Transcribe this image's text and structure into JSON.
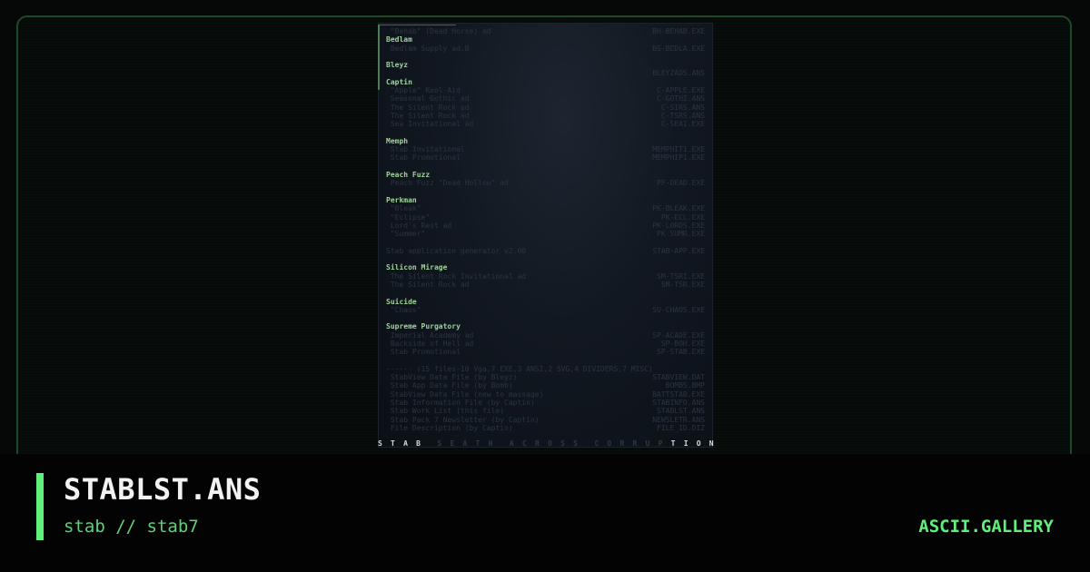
{
  "artwork": {
    "rows": [
      {
        "l": " \"Behab\" (Dead Horse) ad",
        "r": "BH-BEHAB.EXE",
        "head": false
      },
      {
        "l": "Bedlam",
        "r": "",
        "head": true
      },
      {
        "l": " Bedlam Supply ad.B",
        "r": "BS-BEDLA.EXE",
        "head": false
      },
      {
        "l": "",
        "r": "",
        "head": false
      },
      {
        "l": "Bleyz",
        "r": "",
        "head": true
      },
      {
        "l": " ",
        "r": "BLEYZADS.ANS",
        "head": false
      },
      {
        "l": "Captin",
        "r": "",
        "head": true
      },
      {
        "l": " \"Apple\" Kool-Aid",
        "r": "C-APPLE.EXE",
        "head": false
      },
      {
        "l": " Seasonal Gothic ad",
        "r": "C-GOTHI.ANS",
        "head": false
      },
      {
        "l": " The Silent Rock ad",
        "r": "C-SIRS.ANS",
        "head": false
      },
      {
        "l": " The Silent Rock ad",
        "r": "C-TSRS.ANS",
        "head": false
      },
      {
        "l": " Sea Invitational ad",
        "r": "C-SEAI.EXE",
        "head": false
      },
      {
        "l": "",
        "r": "",
        "head": false
      },
      {
        "l": "Memph",
        "r": "",
        "head": true
      },
      {
        "l": " Stab Invitational",
        "r": "MEMPHIT1.EXE",
        "head": false
      },
      {
        "l": " Stab Promotional",
        "r": "MEMPHIP1.EXE",
        "head": false
      },
      {
        "l": "",
        "r": "",
        "head": false
      },
      {
        "l": "Peach Fuzz",
        "r": "",
        "head": true
      },
      {
        "l": " Peach Fuzz \"Dead Hollow\" ad",
        "r": "PF-DEAD.EXE",
        "head": false
      },
      {
        "l": "",
        "r": "",
        "head": false
      },
      {
        "l": "Perkman",
        "r": "",
        "head": true
      },
      {
        "l": " \"Bleak\"",
        "r": "PK-BLEAK.EXE",
        "head": false
      },
      {
        "l": " \"Eclipse\"",
        "r": "PK-ECL.EXE",
        "head": false
      },
      {
        "l": " Lord's Rest ad",
        "r": "PK-LORDS.EXE",
        "head": false
      },
      {
        "l": " \"Summer\"",
        "r": "PK-SUMR.EXE",
        "head": false
      },
      {
        "l": "",
        "r": "",
        "head": false
      },
      {
        "l": "Stab application generator v2.00",
        "r": "STAB-APP.EXE",
        "head": false
      },
      {
        "l": "",
        "r": "",
        "head": false
      },
      {
        "l": "Silicon Mirage",
        "r": "",
        "head": true
      },
      {
        "l": " The Silent Rock Invitational ad",
        "r": "SM-TSRI.EXE",
        "head": false
      },
      {
        "l": " The Silent Rock ad",
        "r": "SM-TSR.EXE",
        "head": false
      },
      {
        "l": "",
        "r": "",
        "head": false
      },
      {
        "l": "Suicide",
        "r": "",
        "head": true
      },
      {
        "l": " \"Chaos\"",
        "r": "SU-CHAOS.EXE",
        "head": false
      },
      {
        "l": "",
        "r": "",
        "head": false
      },
      {
        "l": "Supreme Purgatory",
        "r": "",
        "head": true
      },
      {
        "l": " Imperial Academy ad",
        "r": "SP-ACADE.EXE",
        "head": false
      },
      {
        "l": " Backside of Hell ad",
        "r": "SP-BOH.EXE",
        "head": false
      },
      {
        "l": " Stab Promotional",
        "r": "SP-STAB.EXE",
        "head": false
      },
      {
        "l": "",
        "r": "",
        "head": false
      },
      {
        "l": "------ (15 files-10 Vga,7 EXE,3 ANSI,2 SVG,4 DIVIDERS,7 MISC)",
        "r": "",
        "head": false
      },
      {
        "l": " StabView Data File (by Bleyz)",
        "r": "STABVIEW.DAT",
        "head": false
      },
      {
        "l": " Stab App Data File (by Bomb)",
        "r": "BOMBS.BMP",
        "head": false
      },
      {
        "l": " StabView Data File (new to massage)",
        "r": "BATTSTAB.EXE",
        "head": false
      },
      {
        "l": " Stab Information File (by Captin)",
        "r": "STABINFO.ANS",
        "head": false
      },
      {
        "l": " Stab Work List (this file)",
        "r": "STABLST.ANS",
        "head": false
      },
      {
        "l": " Stab Pack 7 Newsletter (by Captin)",
        "r": "NEWSLETR.ANS",
        "head": false
      },
      {
        "l": " File Description (by Captin)",
        "r": "FILE_ID.DIZ",
        "head": false
      }
    ],
    "footer_letters": [
      {
        "ch": "S",
        "lit": true
      },
      {
        "ch": "T",
        "lit": true
      },
      {
        "ch": "A",
        "lit": true
      },
      {
        "ch": "B",
        "lit": true
      },
      {
        "ch": " ",
        "lit": false
      },
      {
        "ch": "S",
        "lit": false
      },
      {
        "ch": "E",
        "lit": false
      },
      {
        "ch": "A",
        "lit": false
      },
      {
        "ch": "T",
        "lit": false
      },
      {
        "ch": "H",
        "lit": false
      },
      {
        "ch": " ",
        "lit": false
      },
      {
        "ch": "A",
        "lit": false
      },
      {
        "ch": "C",
        "lit": false
      },
      {
        "ch": "R",
        "lit": false
      },
      {
        "ch": "O",
        "lit": false
      },
      {
        "ch": "S",
        "lit": false
      },
      {
        "ch": "S",
        "lit": false
      },
      {
        "ch": " ",
        "lit": false
      },
      {
        "ch": "C",
        "lit": false
      },
      {
        "ch": "O",
        "lit": false
      },
      {
        "ch": "R",
        "lit": false
      },
      {
        "ch": "R",
        "lit": false
      },
      {
        "ch": "U",
        "lit": false
      },
      {
        "ch": "P",
        "lit": false
      },
      {
        "ch": "T",
        "lit": true
      },
      {
        "ch": "I",
        "lit": true
      },
      {
        "ch": "O",
        "lit": true
      },
      {
        "ch": "N",
        "lit": true
      }
    ]
  },
  "title": "STABLST.ANS",
  "subtitle": "stab // stab7",
  "brand": "ASCII.GALLERY",
  "colors": {
    "accent": "#5ef07a",
    "subtitle": "#62d07a",
    "heading": "#9fd39a",
    "background": "#050806"
  }
}
